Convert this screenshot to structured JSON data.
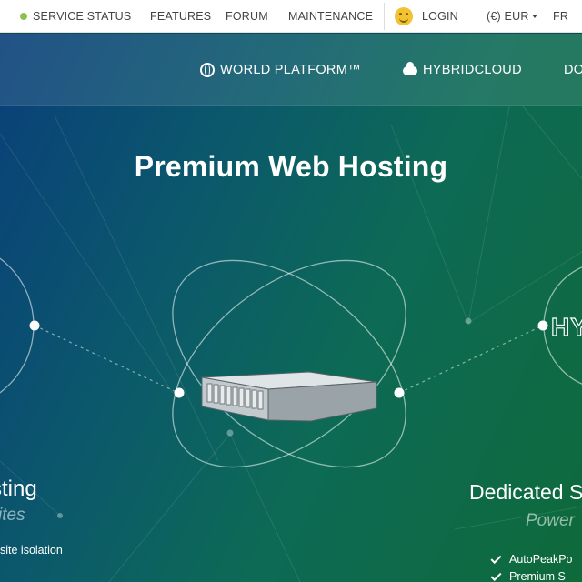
{
  "topbar": {
    "service_status": "SERVICE STATUS",
    "features": "FEATURES",
    "forum": "FORUM",
    "maintenance": "MAINTENANCE",
    "login": "LOGIN",
    "currency": "(€) EUR",
    "language": "FR"
  },
  "nav": {
    "world_platform": "WORLD PLATFORM™",
    "hybridcloud": "HYBRIDCLOUD",
    "cut_item": "DO"
  },
  "hero": {
    "title": "Premium Web Hosting",
    "left_title": "sting",
    "left_subtitle": "ites",
    "left_feature": "site isolation",
    "right_badge": "HY",
    "right_title": "Dedicated S",
    "right_subtitle": "Power",
    "right_features": [
      "AutoPeakPo",
      "Premium S"
    ]
  },
  "colors": {
    "status_ok": "#8cc04f",
    "smiley": "#f2c230",
    "hero_start": "#0a3f7a",
    "hero_end": "#0e6a3a"
  }
}
